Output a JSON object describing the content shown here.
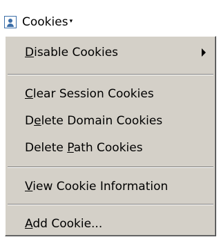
{
  "toolbar": {
    "button_label": "Cookies",
    "button_icon": "cookie-person-icon",
    "dropdown_icon": "dropdown-arrow-icon"
  },
  "menu": {
    "items": [
      {
        "pre": "",
        "mnemonic": "D",
        "post": "isable Cookies",
        "has_submenu": true
      },
      {
        "pre": "",
        "mnemonic": "C",
        "post": "lear Session Cookies"
      },
      {
        "pre": "D",
        "mnemonic": "e",
        "post": "lete Domain Cookies"
      },
      {
        "pre": "Delete ",
        "mnemonic": "P",
        "post": "ath Cookies"
      },
      {
        "pre": "",
        "mnemonic": "V",
        "post": "iew Cookie Information"
      },
      {
        "pre": "",
        "mnemonic": "A",
        "post": "dd Cookie..."
      }
    ]
  },
  "colors": {
    "menu_bg": "#d4d0c8",
    "text": "#000000",
    "icon": "#3b6ea8"
  }
}
